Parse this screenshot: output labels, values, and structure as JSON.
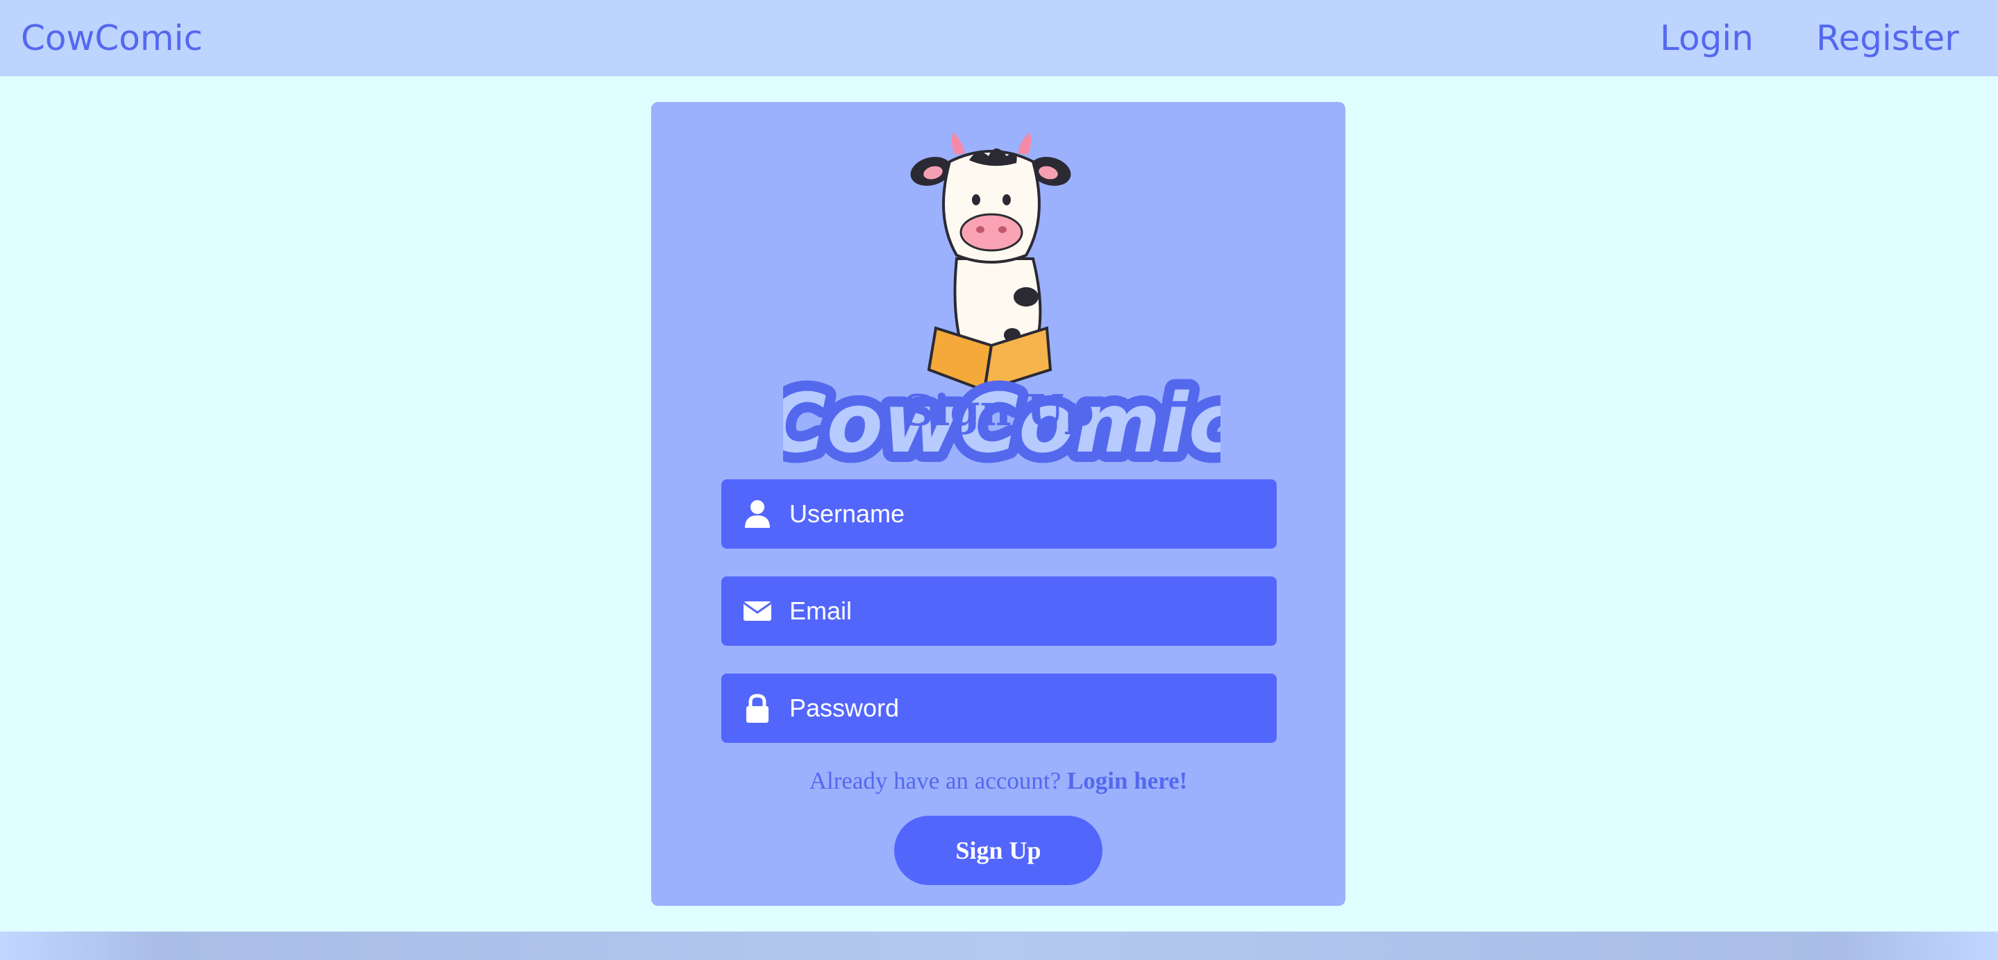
{
  "navbar": {
    "brand": "CowComic",
    "links": [
      {
        "label": "Login"
      },
      {
        "label": "Register"
      }
    ]
  },
  "card": {
    "logo_text": "CowComic",
    "title": "Sign Up",
    "fields": [
      {
        "placeholder": "Username",
        "icon": "user-icon"
      },
      {
        "placeholder": "Email",
        "icon": "envelope-icon"
      },
      {
        "placeholder": "Password",
        "icon": "lock-icon"
      }
    ],
    "already_text": "Already have an account?",
    "login_link": "Login here!",
    "submit_label": "Sign Up"
  },
  "colors": {
    "page_bg": "#e0feff",
    "navbar_bg": "#bdd4ff",
    "card_bg": "#9bb1fd",
    "accent": "#5366fc",
    "text_accent": "#5468ee"
  }
}
